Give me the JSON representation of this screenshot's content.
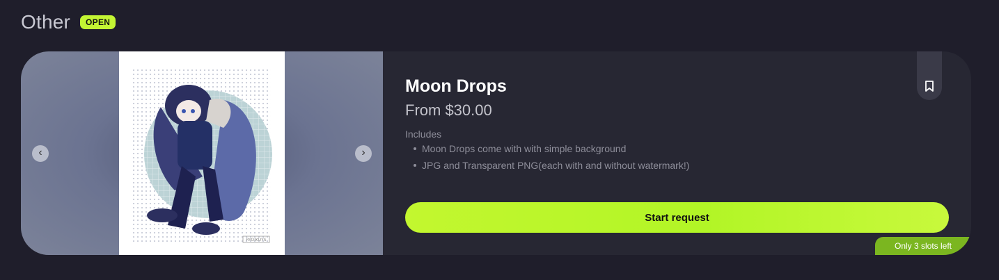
{
  "section": {
    "title": "Other",
    "status_badge": "OPEN"
  },
  "product": {
    "title": "Moon Drops",
    "price": "From $30.00",
    "includes_label": "Includes",
    "includes": [
      "Moon Drops come with with simple background",
      "JPG and Transparent PNG(each with and without watermark!)"
    ],
    "cta_label": "Start request",
    "slots_badge": "Only 3 slots left",
    "artwork_signature": "RYOIKUYS"
  },
  "gallery": {
    "prev_icon": "chevron-left-icon",
    "next_icon": "chevron-right-icon"
  },
  "icons": {
    "bookmark": "bookmark-icon"
  },
  "colors": {
    "accent": "#c3f533",
    "background": "#1f1e2b",
    "card": "#272733",
    "slots_badge": "#7bb620"
  }
}
